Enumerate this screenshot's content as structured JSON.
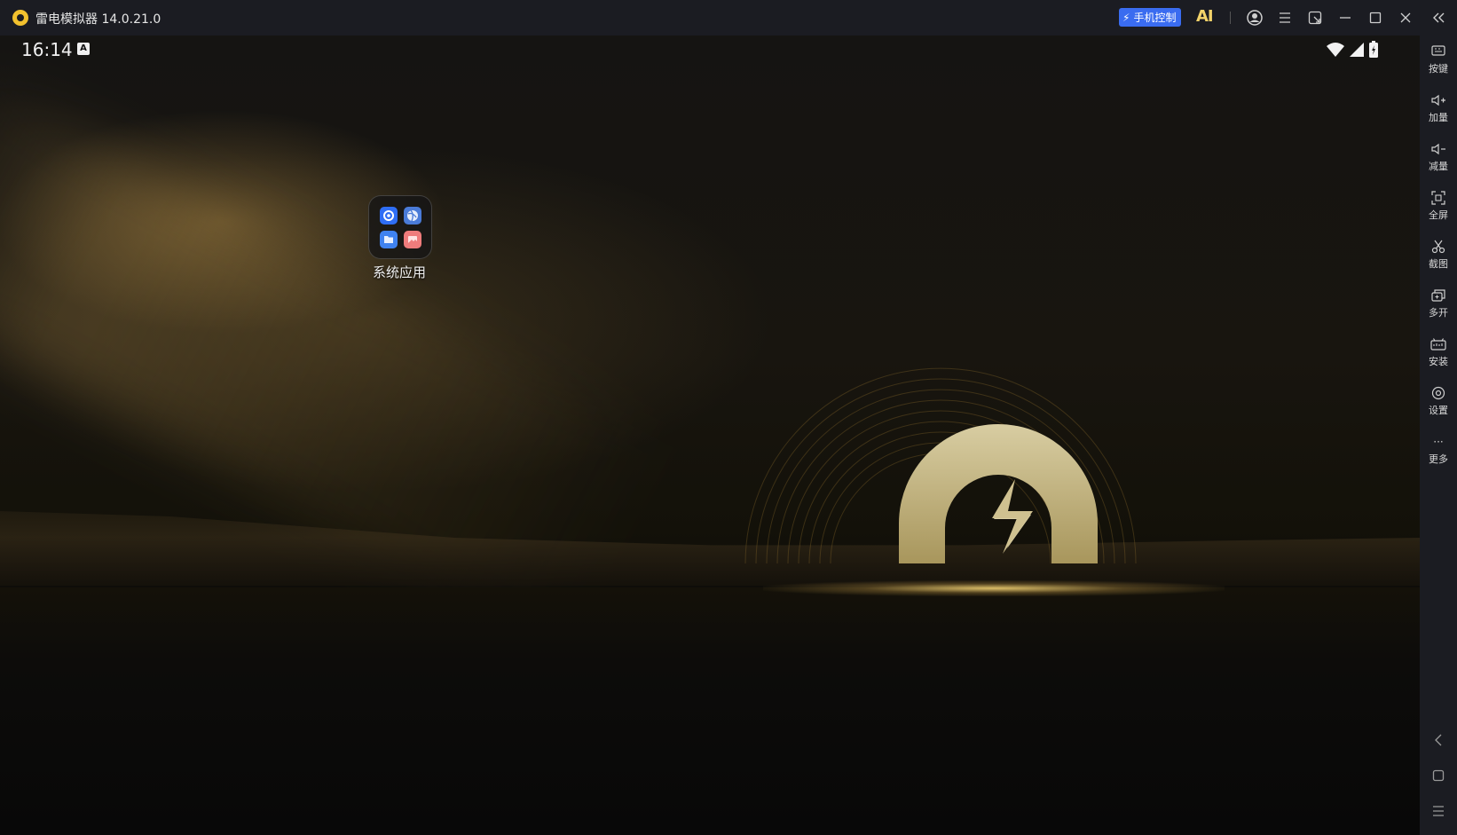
{
  "window": {
    "title": "雷电模拟器 14.0.21.0",
    "phone_control_label": "手机控制",
    "ai_label": "AI"
  },
  "status_bar": {
    "time": "16:14",
    "notification_icon": "A"
  },
  "desktop": {
    "folder_label": "系统应用",
    "folder_icons": [
      "settings-icon",
      "browser-icon",
      "files-icon",
      "gallery-icon"
    ]
  },
  "sidebar": {
    "items": [
      {
        "label": "按键",
        "icon": "keyboard-icon"
      },
      {
        "label": "加量",
        "icon": "volume-up-icon"
      },
      {
        "label": "减量",
        "icon": "volume-down-icon"
      },
      {
        "label": "全屏",
        "icon": "fullscreen-icon"
      },
      {
        "label": "截图",
        "icon": "scissors-icon"
      },
      {
        "label": "多开",
        "icon": "multi-instance-icon"
      },
      {
        "label": "安装",
        "icon": "apk-install-icon"
      },
      {
        "label": "设置",
        "icon": "gear-icon"
      },
      {
        "label": "更多",
        "icon": "more-icon"
      }
    ]
  },
  "colors": {
    "titlebar_bg": "#1b1c22",
    "accent_blue": "#3a6cf0",
    "brand_yellow": "#f2c12e"
  }
}
